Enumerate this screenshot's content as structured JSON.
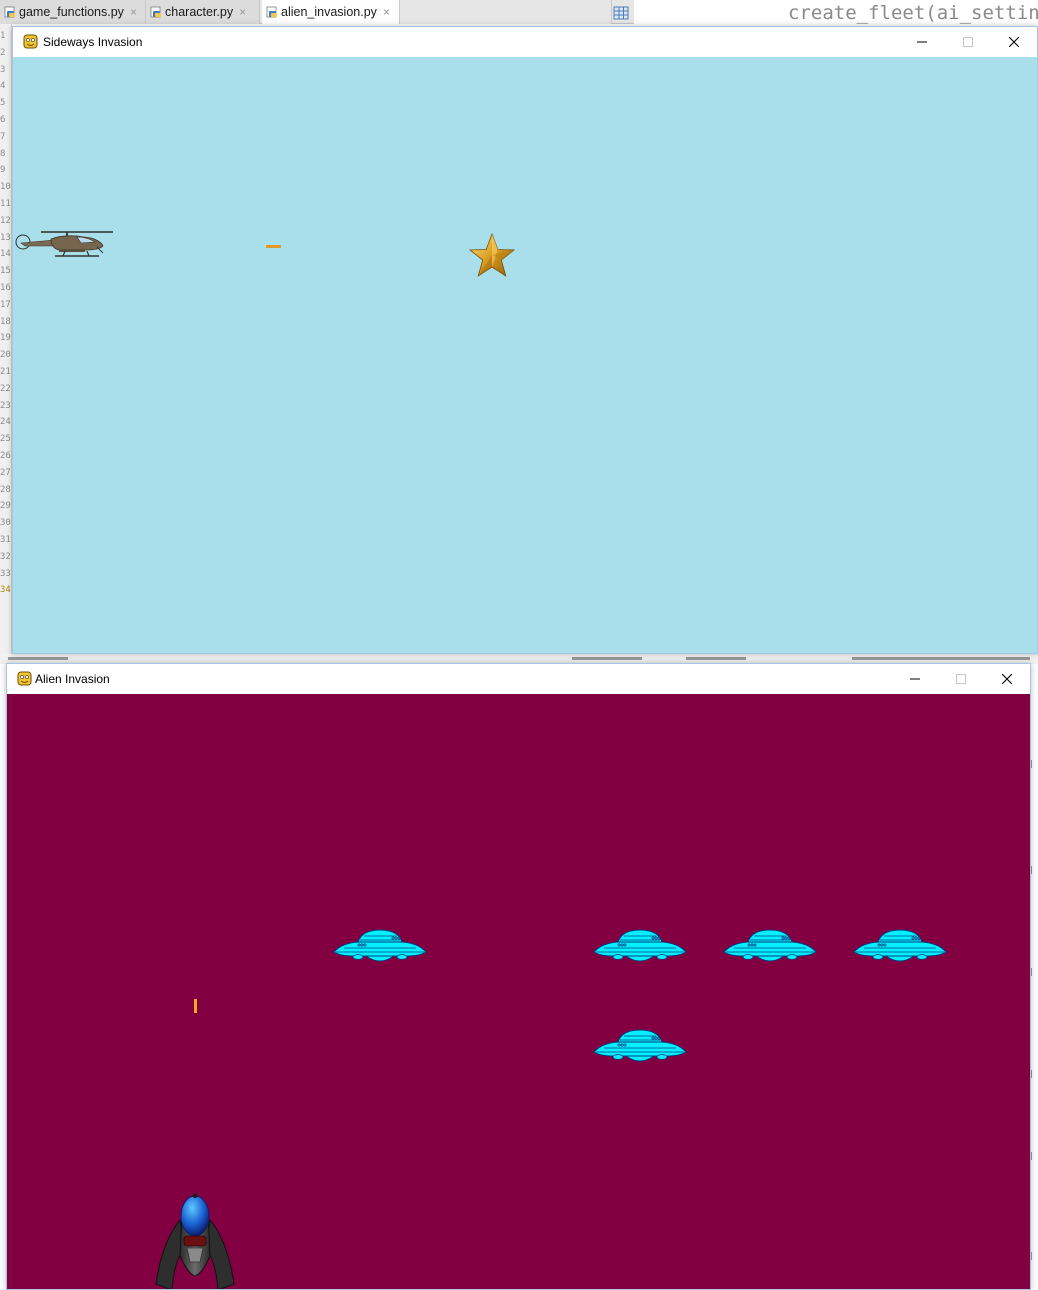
{
  "ide": {
    "tabs": [
      {
        "label": "game_functions.py",
        "active": false
      },
      {
        "label": "character.py",
        "active": false
      },
      {
        "label": "alien_invasion.py",
        "active": true
      }
    ],
    "close_glyph": "×",
    "code_fragment": "create_fleet(ai_settings",
    "line_numbers": [
      "1",
      "2",
      "3",
      "4",
      "5",
      "6",
      "7",
      "8",
      "9",
      "10",
      "11",
      "12",
      "13",
      "14",
      "15",
      "16",
      "17",
      "18",
      "19",
      "20",
      "21",
      "22",
      "23",
      "24",
      "25",
      "26",
      "27",
      "28",
      "29",
      "30",
      "31",
      "32",
      "33",
      "34"
    ],
    "current_line": "34",
    "icons": {
      "file": "python-file-icon",
      "grid": "grid-icon"
    }
  },
  "windows": {
    "sideways": {
      "title": "Sideways Invasion",
      "icon": "pygame-snake-icon",
      "background": "#a8dfeb",
      "sprites": [
        "helicopter",
        "bullet-horizontal",
        "gold-star"
      ]
    },
    "alien": {
      "title": "Alien Invasion",
      "icon": "pygame-snake-icon",
      "background": "#820041",
      "alien_count": 5,
      "sprites": [
        "ufo",
        "ufo",
        "ufo",
        "ufo",
        "ufo",
        "bullet-vertical",
        "player-ship"
      ]
    },
    "controls": {
      "minimize": "minimize-icon",
      "maximize": "maximize-icon",
      "close": "close-icon"
    }
  },
  "colors": {
    "bullet": "#f5a623",
    "ufo_body": "#00f0ff",
    "ufo_outline": "#0b3a7a",
    "star": "#e0a82e",
    "titlebar_border": "#a8c7e8"
  }
}
